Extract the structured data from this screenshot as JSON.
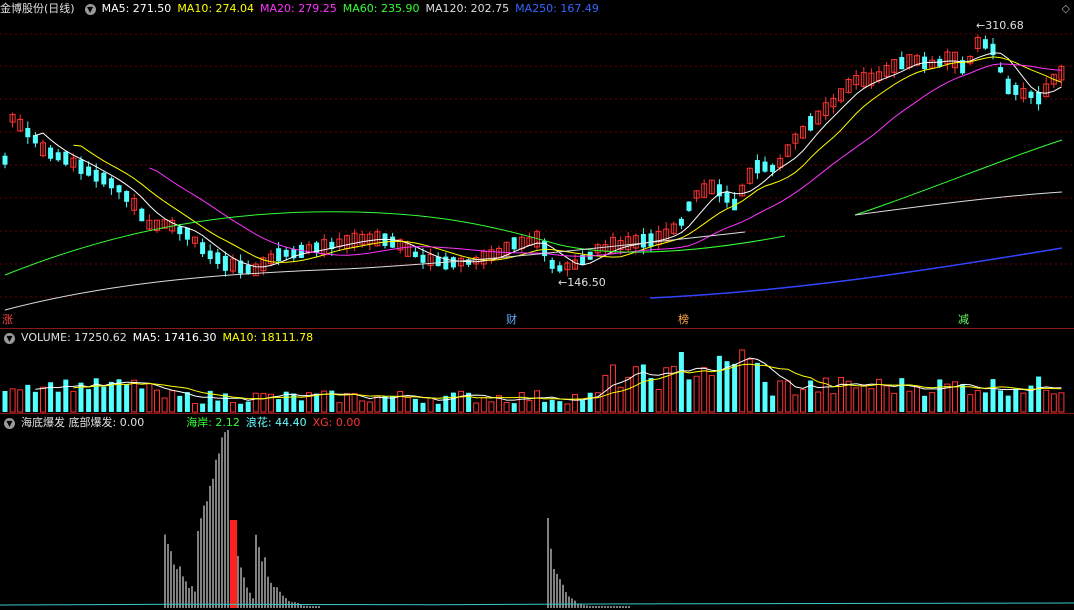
{
  "header": {
    "stock": "金博股份(日线)",
    "ma": [
      {
        "label": "MA5: 271.50",
        "color": "#ffffff"
      },
      {
        "label": "MA10: 274.04",
        "color": "#ffff00"
      },
      {
        "label": "MA20: 279.25",
        "color": "#ff33ff"
      },
      {
        "label": "MA60: 235.90",
        "color": "#33ff33"
      },
      {
        "label": "MA120: 202.75",
        "color": "#dddddd"
      },
      {
        "label": "MA250: 167.49",
        "color": "#3366ff"
      }
    ]
  },
  "price_panel": {
    "high_label": "310.68",
    "low_label": "146.50",
    "events": [
      {
        "label": "涨",
        "color": "#ff4444"
      },
      {
        "label": "财",
        "color": "#66aaff"
      },
      {
        "label": "榜",
        "color": "#ffaa44"
      },
      {
        "label": "减",
        "color": "#66ff66"
      }
    ]
  },
  "volume_panel": {
    "title": "VOLUME: 17250.62",
    "ma5": "MA5: 17416.30",
    "ma10": "MA10: 18111.78"
  },
  "indicator_panel": {
    "title": "海底爆发 底部爆发: 0.00",
    "haian": "海岸: 2.12",
    "langhua": "浪花: 44.40",
    "xg": "XG: 0.00"
  },
  "colors": {
    "up": "#ff3232",
    "down": "#54ffff",
    "grid": "#6b0000",
    "separator": "#8a1a1a"
  }
}
